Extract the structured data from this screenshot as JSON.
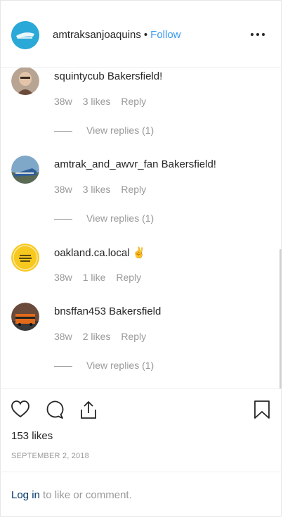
{
  "header": {
    "username": "amtraksanjoaquins",
    "separator": "•",
    "follow_label": "Follow"
  },
  "comments": [
    {
      "username": "squintycub",
      "text": "Bakersfield!",
      "age": "38w",
      "likes": "3 likes",
      "reply": "Reply",
      "view_replies": "View replies (1)"
    },
    {
      "username": "amtrak_and_awvr_fan",
      "text": "Bakersfield!",
      "age": "38w",
      "likes": "3 likes",
      "reply": "Reply",
      "view_replies": "View replies (1)"
    },
    {
      "username": "oakland.ca.local",
      "text": "✌",
      "age": "38w",
      "likes": "1 like",
      "reply": "Reply",
      "view_replies": ""
    },
    {
      "username": "bnsffan453",
      "text": "Bakersfield",
      "age": "38w",
      "likes": "2 likes",
      "reply": "Reply",
      "view_replies": "View replies (1)"
    }
  ],
  "post": {
    "likes": "153 likes",
    "date": "SEPTEMBER 2, 2018"
  },
  "footer": {
    "login_link": "Log in",
    "login_suffix": " to like or comment."
  },
  "colors": {
    "link": "#3897f0",
    "muted": "#999999",
    "text": "#262626",
    "login_link": "#003569"
  },
  "icons": [
    "more-options-icon",
    "heart-icon",
    "comment-icon",
    "share-icon",
    "bookmark-icon"
  ]
}
